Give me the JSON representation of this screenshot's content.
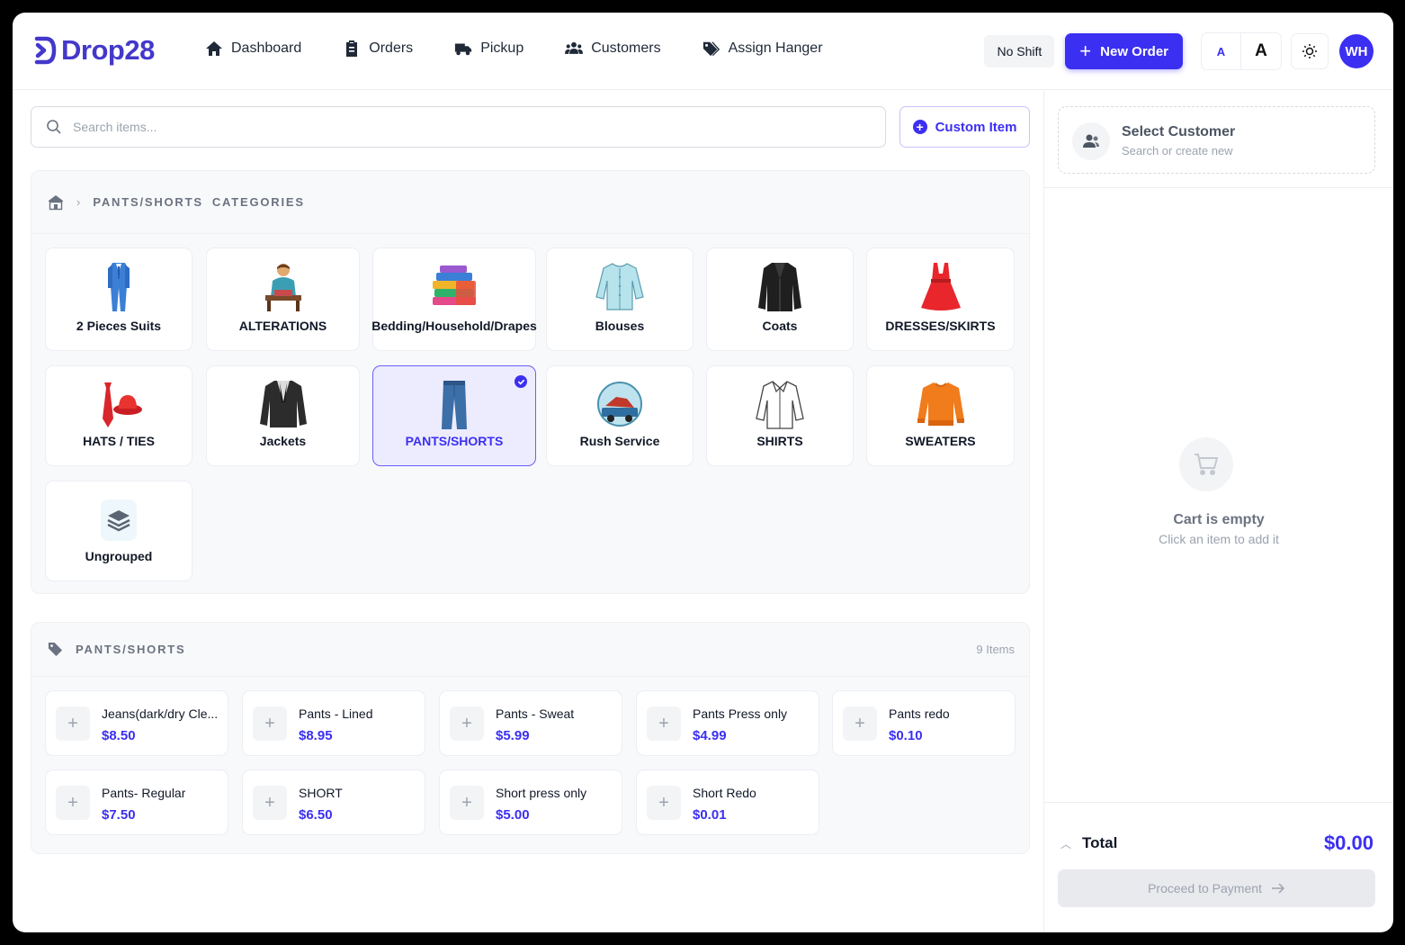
{
  "brand": {
    "name": "Drop28",
    "color": "#3b2ff2"
  },
  "nav": [
    {
      "label": "Dashboard",
      "icon": "home-icon"
    },
    {
      "label": "Orders",
      "icon": "clipboard-icon"
    },
    {
      "label": "Pickup",
      "icon": "truck-icon"
    },
    {
      "label": "Customers",
      "icon": "users-icon"
    },
    {
      "label": "Assign Hanger",
      "icon": "tags-icon"
    }
  ],
  "header": {
    "shift": "No Shift",
    "new_order": "New Order",
    "font_small": "A",
    "font_large": "A",
    "avatar": "WH"
  },
  "search": {
    "placeholder": "Search items..."
  },
  "custom_item": "Custom Item",
  "breadcrumb": {
    "first": "PANTS/SHORTS",
    "second": "CATEGORIES"
  },
  "categories": [
    {
      "label": "2 Pieces Suits"
    },
    {
      "label": "ALTERATIONS"
    },
    {
      "label": "Bedding/Household/Drapes"
    },
    {
      "label": "Blouses"
    },
    {
      "label": "Coats"
    },
    {
      "label": "DRESSES/SKIRTS"
    },
    {
      "label": "HATS / TIES"
    },
    {
      "label": "Jackets"
    },
    {
      "label": "PANTS/SHORTS",
      "selected": true
    },
    {
      "label": "Rush Service"
    },
    {
      "label": "SHIRTS"
    },
    {
      "label": "SWEATERS"
    },
    {
      "label": "Ungrouped"
    }
  ],
  "items_section": {
    "title": "PANTS/SHORTS",
    "count": "9 Items"
  },
  "items": [
    {
      "name": "Jeans(dark/dry Cle...",
      "price": "$8.50"
    },
    {
      "name": "Pants - Lined",
      "price": "$8.95"
    },
    {
      "name": "Pants - Sweat",
      "price": "$5.99"
    },
    {
      "name": "Pants Press only",
      "price": "$4.99"
    },
    {
      "name": "Pants redo",
      "price": "$0.10"
    },
    {
      "name": "Pants- Regular",
      "price": "$7.50"
    },
    {
      "name": "SHORT",
      "price": "$6.50"
    },
    {
      "name": "Short press only",
      "price": "$5.00"
    },
    {
      "name": "Short Redo",
      "price": "$0.01"
    }
  ],
  "cart": {
    "customer_title": "Select Customer",
    "customer_sub": "Search or create new",
    "empty_title": "Cart is empty",
    "empty_sub": "Click an item to add it",
    "total_label": "Total",
    "total_value": "$0.00",
    "pay_label": "Proceed to Payment"
  }
}
